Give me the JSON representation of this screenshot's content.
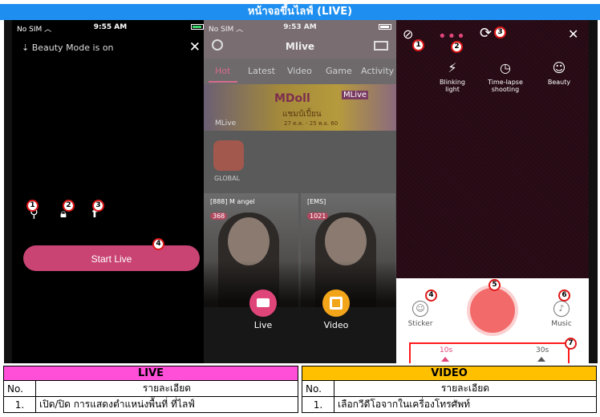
{
  "header": {
    "title": "หน้าจอขึ้นไลฟ์ (LIVE)"
  },
  "colors": {
    "header_bg": "#1e8ff0",
    "live_accent": "#ff4fd8",
    "video_accent": "#ffc000",
    "brand_pink": "#e0457a",
    "badge_border": "#e01818"
  },
  "status_bar": {
    "carrier": "No SIM",
    "time_left": "9:55 AM",
    "time_mid": "9:53 AM",
    "time_right": ""
  },
  "live_screen": {
    "beauty_text": "Beauty Mode is on",
    "start_button": "Start Live",
    "icons": [
      "location-icon",
      "lock-icon",
      "facebook-icon"
    ],
    "badges": [
      "1",
      "2",
      "3",
      "4"
    ]
  },
  "app_screen": {
    "logo": "Mlive",
    "tabs": [
      "Hot",
      "Latest",
      "Video",
      "Game",
      "Activity"
    ],
    "banner": {
      "title": "MDoll",
      "subtitle": "แชมป์เปี้ยน",
      "brand": "MLive",
      "tag": "MLive",
      "dates": "27 ต.ค. - 25 พ.ย. 60"
    },
    "global_label": "GLOBAL",
    "thumbs": [
      {
        "name": "[888] M angel",
        "count": "368"
      },
      {
        "name": "[EMS]",
        "count": "1021"
      }
    ],
    "live_label": "Live",
    "video_label": "Video"
  },
  "video_screen": {
    "tools": [
      {
        "icon": "flash-icon",
        "label": "Blinking light"
      },
      {
        "icon": "timer-icon",
        "label": "Time-lapse shooting"
      },
      {
        "icon": "beauty-icon",
        "label": "Beauty"
      }
    ],
    "sticker_label": "Sticker",
    "music_label": "Music",
    "time_options": [
      "10s",
      "30s"
    ],
    "badges": [
      "1",
      "2",
      "3",
      "4",
      "5",
      "6",
      "7"
    ]
  },
  "tables": {
    "live": {
      "caption": "LIVE",
      "col_no": "No.",
      "col_detail": "รายละเอียด",
      "rows": [
        {
          "no": "1.",
          "detail": "เปิด/ปิด การแสดงตำแหน่งพื้นที่ ที่ไลฟ์"
        }
      ]
    },
    "video": {
      "caption": "VIDEO",
      "col_no": "No.",
      "col_detail": "รายละเอียด",
      "rows": [
        {
          "no": "1.",
          "detail": "เลือกวีดีโอจากในเครื่องโทรศัพท์"
        }
      ]
    }
  }
}
